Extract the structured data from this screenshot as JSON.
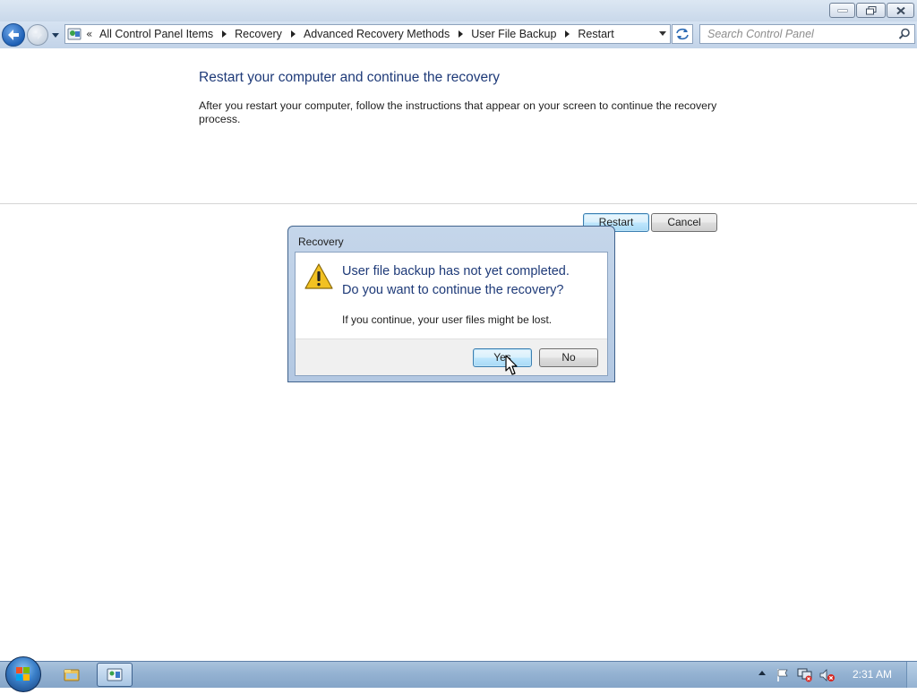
{
  "window": {
    "caption_buttons": [
      "minimize",
      "restore",
      "close"
    ]
  },
  "nav": {
    "breadcrumbs": [
      "All Control Panel Items",
      "Recovery",
      "Advanced Recovery Methods",
      "User File Backup",
      "Restart"
    ],
    "overflow_chevron": "«",
    "search_placeholder": "Search Control Panel"
  },
  "content": {
    "title": "Restart your computer and continue the recovery",
    "instructions": "After you restart your computer, follow the instructions that appear on your screen to continue the recovery process.",
    "restart_label": "Restart",
    "cancel_label": "Cancel"
  },
  "dialog": {
    "title": "Recovery",
    "main_line1": "User file backup has not yet completed.",
    "main_line2": "Do you want to continue the recovery?",
    "sub_text": "If you continue, your user files might be lost.",
    "yes_label": "Yes",
    "no_label": "No",
    "icon": "warning-icon"
  },
  "taskbar": {
    "pinned": [
      "explorer-icon",
      "control-panel-icon"
    ],
    "tray_icons": [
      "show-hidden-icons-arrow",
      "action-center-flag-icon",
      "network-icon",
      "volume-muted-icon"
    ],
    "clock": "2:31 AM"
  }
}
